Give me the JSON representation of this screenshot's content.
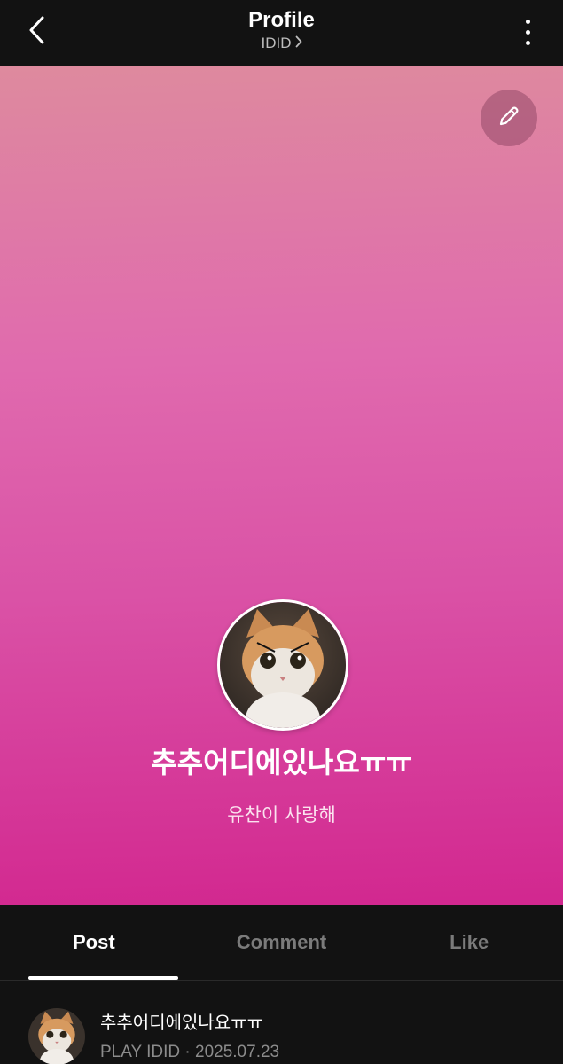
{
  "header": {
    "title": "Profile",
    "subtitle": "IDID",
    "icons": {
      "back": "chevron-left-icon",
      "subtitle_arrow": "chevron-right-icon",
      "more": "more-vertical-icon"
    }
  },
  "profile": {
    "nickname": "추추어디에있나요ㅠㅠ",
    "bio": "유찬이 사랑해",
    "edit_icon": "pencil-icon",
    "avatar": "cat-photo-avatar"
  },
  "tabs": [
    {
      "label": "Post",
      "active": true
    },
    {
      "label": "Comment",
      "active": false
    },
    {
      "label": "Like",
      "active": false
    }
  ],
  "posts": [
    {
      "author": "추추어디에있나요ㅠㅠ",
      "source": "PLAY IDID",
      "separator": "·",
      "date": "2025.07.23"
    }
  ],
  "colors": {
    "background": "#121212",
    "hero_top": "#de8a9e",
    "hero_bottom": "#d2278f",
    "tab_active": "#ffffff",
    "tab_inactive": "#7b7b7b"
  }
}
